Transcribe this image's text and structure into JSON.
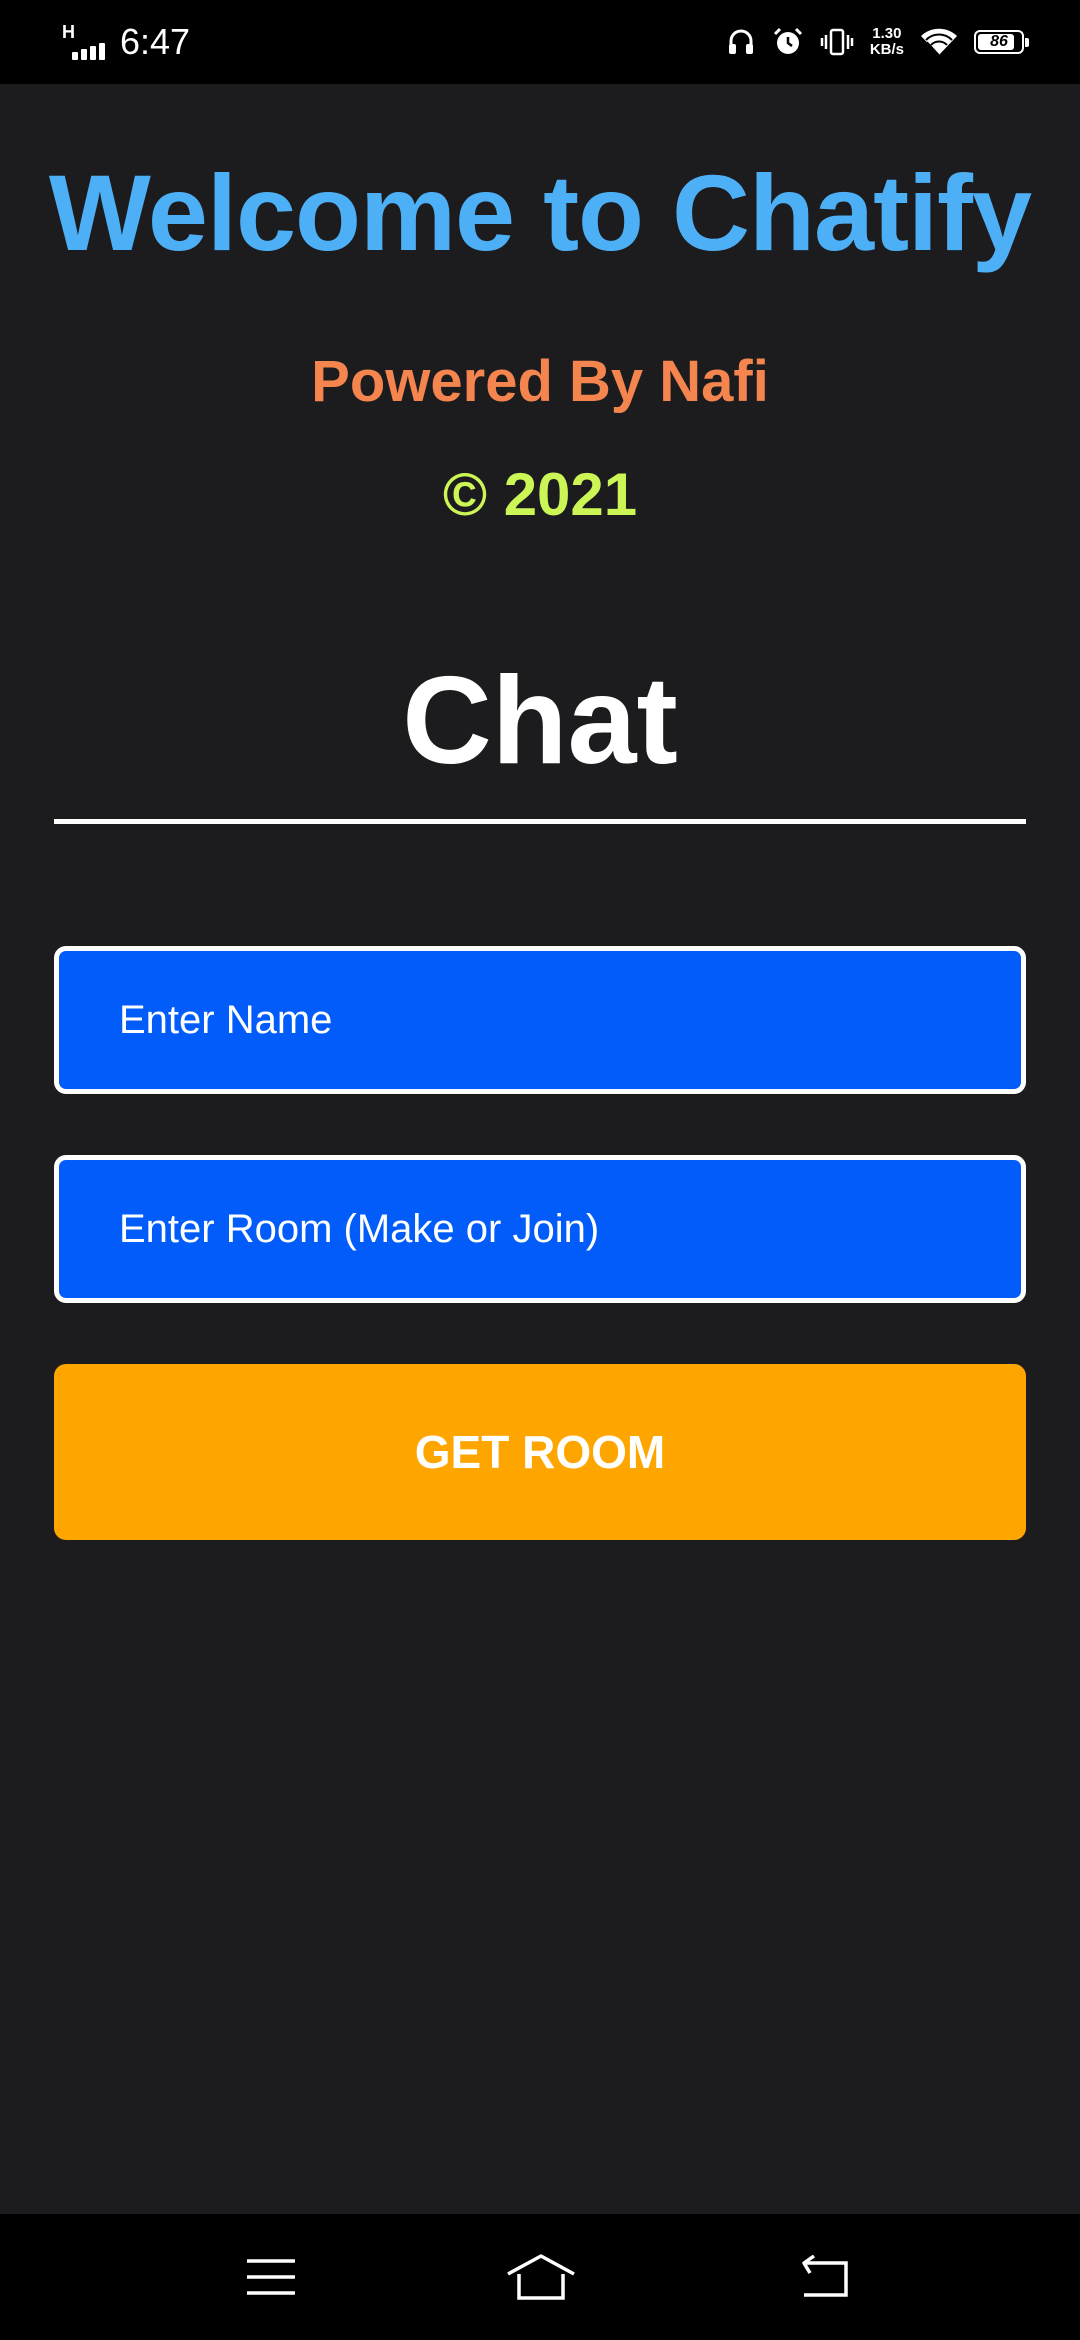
{
  "status_bar": {
    "network_type": "H",
    "time": "6:47",
    "speed_value": "1.30",
    "speed_unit": "KB/s",
    "battery_level": "86",
    "icons": [
      "headphones-icon",
      "alarm-icon",
      "vibrate-icon",
      "wifi-icon",
      "battery-icon"
    ]
  },
  "header": {
    "welcome": "Welcome to Chatify",
    "powered_by": "Powered By Nafi",
    "copyright": "© 2021"
  },
  "chat": {
    "title": "Chat"
  },
  "form": {
    "name_placeholder": "Enter Name",
    "name_value": "",
    "room_placeholder": "Enter Room (Make or Join)",
    "room_value": "",
    "submit_label": "GET ROOM"
  },
  "nav_bar": {
    "icons": [
      "menu-icon",
      "home-icon",
      "back-icon"
    ]
  },
  "colors": {
    "background": "#1c1c1e",
    "welcome": "#4db0f7",
    "powered_by": "#f5854f",
    "copyright": "#ccf556",
    "input_bg": "#025cf9",
    "button_bg": "#ffa500"
  }
}
